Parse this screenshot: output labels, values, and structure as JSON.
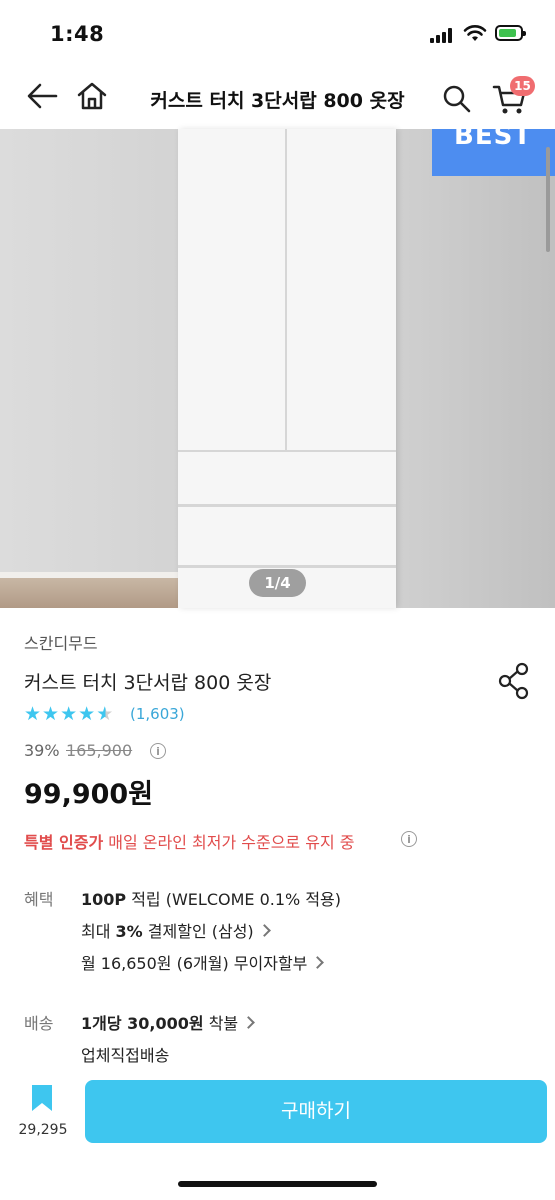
{
  "status_bar": {
    "time": "1:48"
  },
  "nav": {
    "title": "커스트 터치 3단서랍 800 옷장",
    "cart_count": "15"
  },
  "gallery": {
    "badge": "BEST",
    "pager": "1/4"
  },
  "product": {
    "brand": "스칸디무드",
    "name": "커스트 터치 3단서랍 800 옷장",
    "rating": 4.5,
    "review_count": "(1,603)",
    "discount": "39%",
    "original_price": "165,900",
    "price": "99,900원",
    "certification": {
      "highlight": "특별 인증가",
      "text": " 매일 온라인 최저가 수준으로 유지 중"
    }
  },
  "benefits": {
    "label": "혜택",
    "points_bold": "100P",
    "points_text": " 적립 (WELCOME 0.1% 적용)",
    "card_prefix": "최대 ",
    "card_bold": "3%",
    "card_text": " 결제할인 (삼성)",
    "installment": "월 16,650원 (6개월) 무이자할부"
  },
  "shipping": {
    "label": "배송",
    "fee_bold": "1개당 30,000원",
    "fee_text": " 착불",
    "method": "업체직접배송"
  },
  "bottom_bar": {
    "bookmark_count": "29,295",
    "buy_label": "구매하기"
  },
  "colors": {
    "accent": "#3ec6ef",
    "badge": "#f06d70",
    "cert": "#e14c4c",
    "best": "#4d8df0"
  }
}
